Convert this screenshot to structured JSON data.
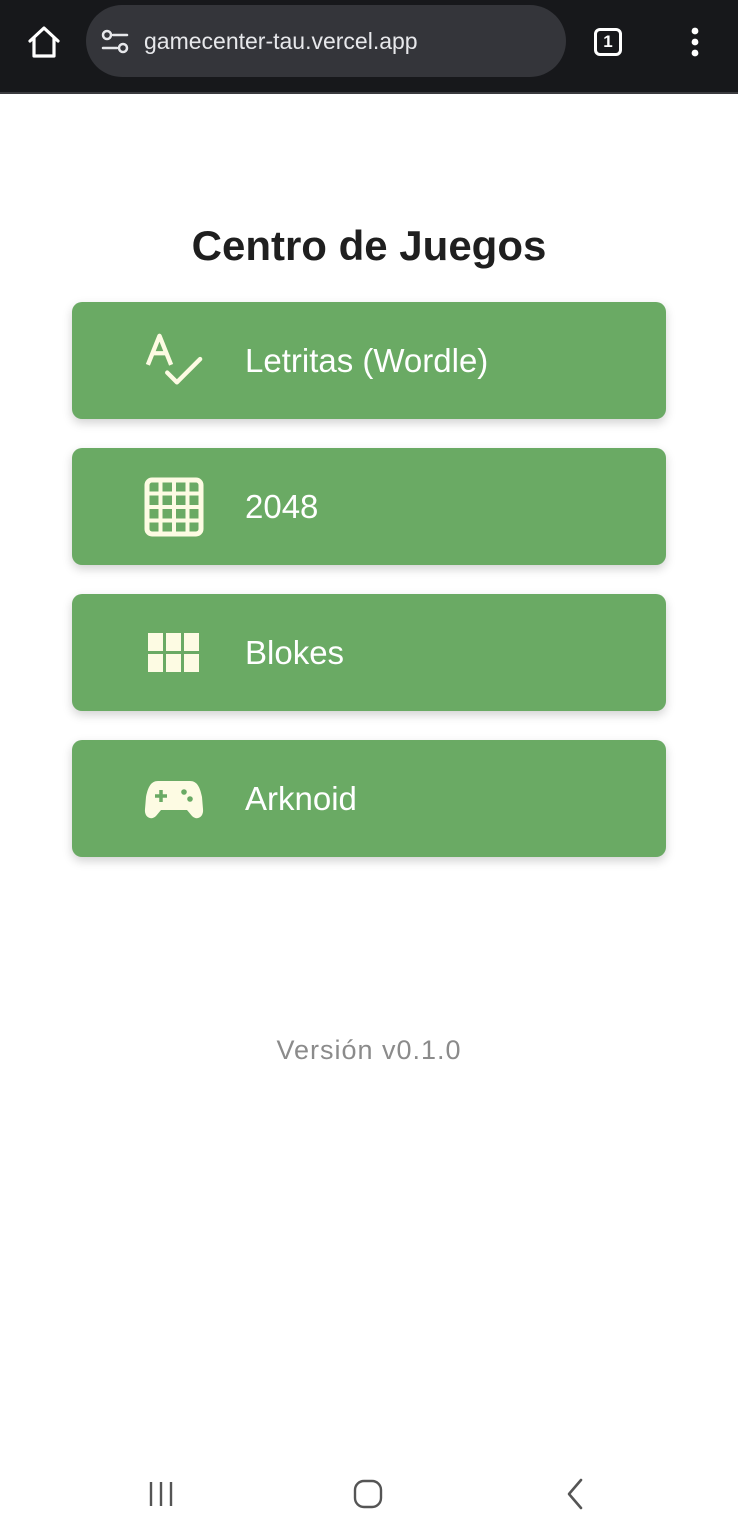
{
  "browser": {
    "url": "gamecenter-tau.vercel.app",
    "tab_count": "1",
    "icons": {
      "home": "home-icon",
      "site_settings": "tune-icon",
      "menu": "more-vert-icon"
    }
  },
  "page": {
    "title": "Centro de Juegos",
    "games": [
      {
        "label": "Letritas (Wordle)",
        "icon": "spellcheck-icon"
      },
      {
        "label": "2048",
        "icon": "grid-4x4-icon"
      },
      {
        "label": "Blokes",
        "icon": "grid-3x2-icon"
      },
      {
        "label": "Arknoid",
        "icon": "gamepad-icon"
      }
    ],
    "version": "Versión v0.1.0"
  },
  "colors": {
    "button_bg": "#6aaa64",
    "icon_fill": "#fdfbe3",
    "browser_bar": "#17181b"
  },
  "system_nav": {
    "icons": [
      "recent-apps-icon",
      "home-circle-icon",
      "back-icon"
    ]
  }
}
